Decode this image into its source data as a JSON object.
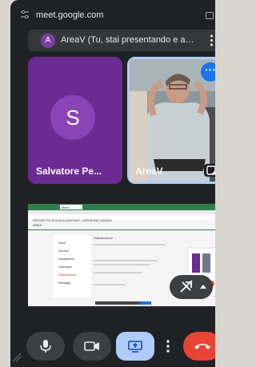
{
  "browser": {
    "url": "meet.google.com"
  },
  "banner": {
    "avatar_letter": "A",
    "text": "AreaV (Tu, stai presentando e aggi..."
  },
  "tiles": [
    {
      "name": "Salvatore Pe...",
      "avatar_letter": "S"
    },
    {
      "name": "AreaV"
    }
  ],
  "shared_screen": {
    "tab_label": "Meet - ...",
    "heading": "Sottoscrizioni",
    "title_line": "PROGETTO SCUOLA DIGITALE - VERSIONE 2023/24",
    "subtitle": "AREA",
    "sidebar_items": [
      "Home",
      "Account",
      "Impostazioni",
      "Calendario",
      "Presentazione",
      "Messaggi"
    ]
  },
  "colors": {
    "accent": "#1a73e8",
    "end_call": "#ea4335",
    "present_active": "#aecbfa",
    "avatar": "#8a44b6"
  },
  "icons": [
    "tune-icon",
    "tabs-icon",
    "more-vert-icon",
    "screen-share-off-icon",
    "pin-icon",
    "mic-icon",
    "videocam-icon",
    "present-icon",
    "call-end-icon"
  ]
}
